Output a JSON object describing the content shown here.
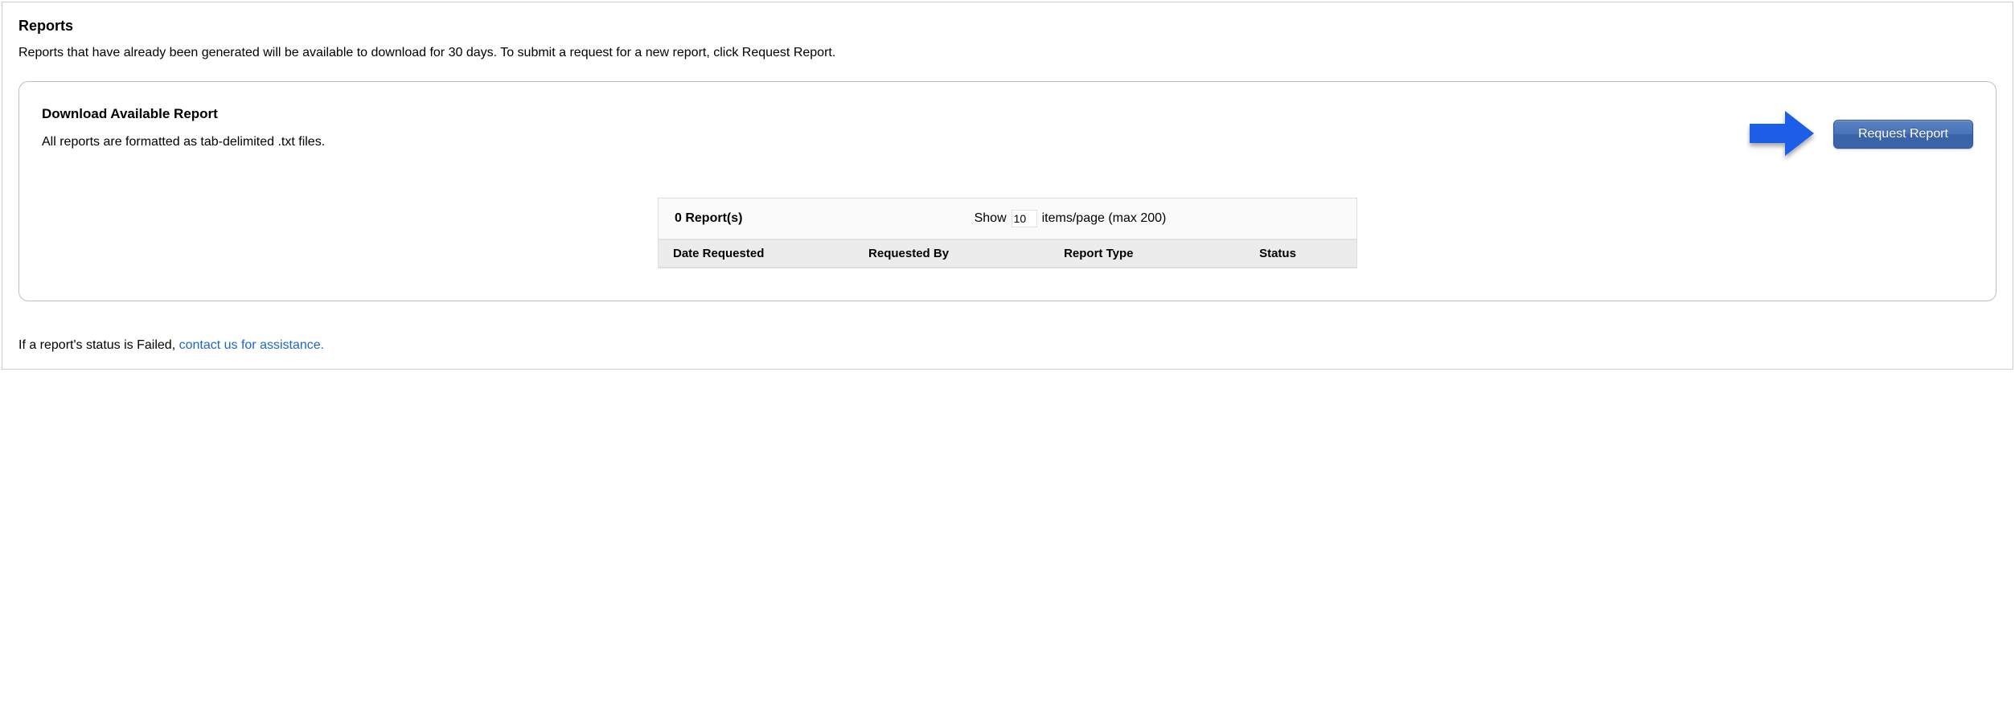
{
  "page": {
    "title": "Reports",
    "intro": "Reports that have already been generated will be available to download for 30 days. To submit a request for a new report, click Request Report."
  },
  "panel": {
    "title": "Download Available Report",
    "subtitle": "All reports are formatted as tab-delimited .txt files.",
    "request_button": "Request Report"
  },
  "table": {
    "count_label": "0 Report(s)",
    "show_prefix": "Show",
    "show_value": "10",
    "show_suffix": "items/page (max 200)",
    "columns": {
      "date_requested": "Date Requested",
      "requested_by": "Requested By",
      "report_type": "Report Type",
      "status": "Status"
    },
    "rows": []
  },
  "footer": {
    "prefix": "If a report's status is Failed, ",
    "link_text": "contact us for assistance."
  }
}
